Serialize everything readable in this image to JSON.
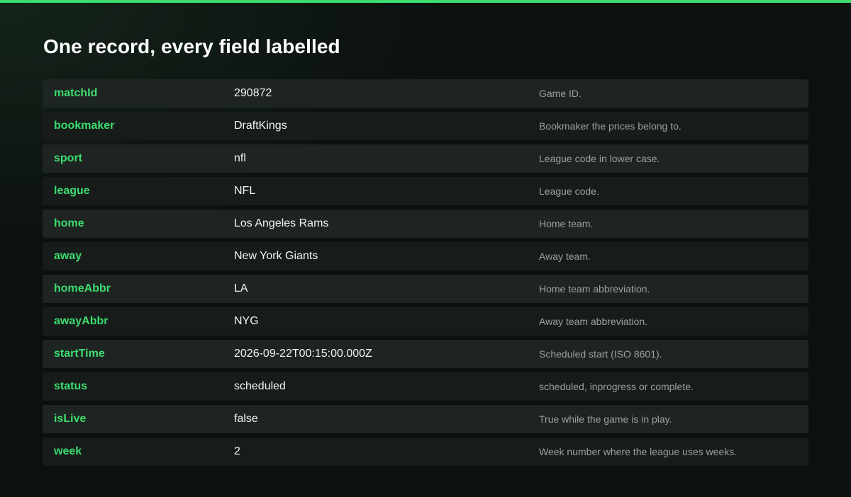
{
  "title": "One record, every field labelled",
  "colors": {
    "accent": "#3ddc6e",
    "background": "#0c110e",
    "row": "#171c1b",
    "row_alt": "#1d2422"
  },
  "rows": [
    {
      "field": "matchId",
      "value": "290872",
      "description": "Game ID."
    },
    {
      "field": "bookmaker",
      "value": "DraftKings",
      "description": "Bookmaker the prices belong to."
    },
    {
      "field": "sport",
      "value": "nfl",
      "description": "League code in lower case."
    },
    {
      "field": "league",
      "value": "NFL",
      "description": "League code."
    },
    {
      "field": "home",
      "value": "Los Angeles Rams",
      "description": "Home team."
    },
    {
      "field": "away",
      "value": "New York Giants",
      "description": "Away team."
    },
    {
      "field": "homeAbbr",
      "value": "LA",
      "description": "Home team abbreviation."
    },
    {
      "field": "awayAbbr",
      "value": "NYG",
      "description": "Away team abbreviation."
    },
    {
      "field": "startTime",
      "value": "2026-09-22T00:15:00.000Z",
      "description": "Scheduled start (ISO 8601)."
    },
    {
      "field": "status",
      "value": "scheduled",
      "description": "scheduled, inprogress or complete."
    },
    {
      "field": "isLive",
      "value": "false",
      "description": "True while the game is in play."
    },
    {
      "field": "week",
      "value": "2",
      "description": "Week number where the league uses weeks."
    }
  ]
}
